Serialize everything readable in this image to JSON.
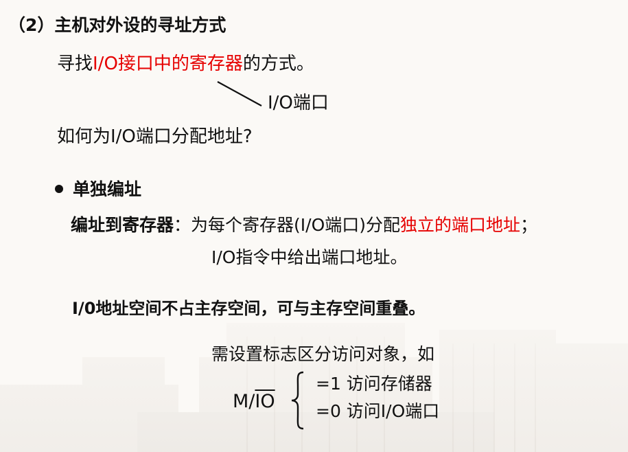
{
  "slide": {
    "title": "（2）主机对外设的寻址方式",
    "line1": {
      "prefix": "寻找",
      "highlight": "I/O接口中的寄存器",
      "suffix": "的方式。"
    },
    "io_port_note": "I/O端口",
    "question": "如何为I/O端口分配地址?",
    "bullet": "单独编址",
    "addressing": {
      "label": "编址到寄存器",
      "colon": "：",
      "text_before": "为每个寄存器(I/O端口)分配",
      "highlight": "独立的端口地址",
      "text_after": "；",
      "line2": "I/O指令中给出端口地址。"
    },
    "io_space": "I/0地址空间不占主存空间，可与主存空间重叠。",
    "flag_intro": "需设置标志区分访问对象，如",
    "mio": {
      "prefix": "M/",
      "overlined": "IO",
      "case1": "=1 访问存储器",
      "case2": "=0 访问I/O端口"
    }
  },
  "colors": {
    "highlight": "#e60000",
    "text": "#111111",
    "background": "#fbf9f6"
  }
}
